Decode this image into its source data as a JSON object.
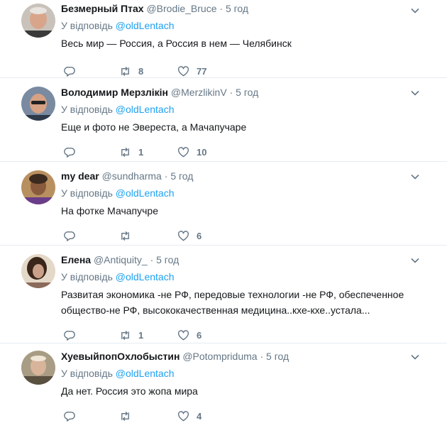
{
  "icons": {
    "reply": "reply-icon",
    "retweet": "retweet-icon",
    "like": "heart-icon",
    "menu": "chevron-down-icon"
  },
  "colors": {
    "link": "#1da1f2",
    "muted": "#657786",
    "divider": "#e6ecf0"
  },
  "tweets": [
    {
      "name": "Безмерный Птах",
      "handle": "@Brodie_Bruce",
      "dot": "·",
      "time": "5 год",
      "reply_prefix": "У відповідь",
      "reply_to": "@oldLentach",
      "text": "Весь мир — Россия, а Россия в нем — Челябинск",
      "retweets": "8",
      "likes": "77"
    },
    {
      "name": "Володимир Мерзлікін",
      "handle": "@MerzlikinV",
      "dot": "·",
      "time": "5 год",
      "reply_prefix": "У відповідь",
      "reply_to": "@oldLentach",
      "text": "Еще и фото не Эвереста, а Мачапучаре",
      "retweets": "1",
      "likes": "10"
    },
    {
      "name": "my dear",
      "handle": "@sundharma",
      "dot": "·",
      "time": "5 год",
      "reply_prefix": "У відповідь",
      "reply_to": "@oldLentach",
      "text": "На фотке Мачапучре",
      "retweets": "",
      "likes": "6"
    },
    {
      "name": "Елена",
      "handle": "@Antiquity_",
      "dot": "·",
      "time": "5 год",
      "reply_prefix": "У відповідь",
      "reply_to": "@oldLentach",
      "text": "Развитая экономика -не РФ, передовые технологии -не РФ, обеспеченное общество-не РФ, высококачественная медицина..кхе-кхе..устала...",
      "retweets": "1",
      "likes": "6"
    },
    {
      "name": "ХуевыйпопОхлобыстин",
      "handle": "@Potompriduma",
      "dot": "·",
      "time": "5 год",
      "reply_prefix": "У відповідь",
      "reply_to": "@oldLentach",
      "text": "Да нет. Россия это жопа мира",
      "retweets": "",
      "likes": "4"
    }
  ]
}
